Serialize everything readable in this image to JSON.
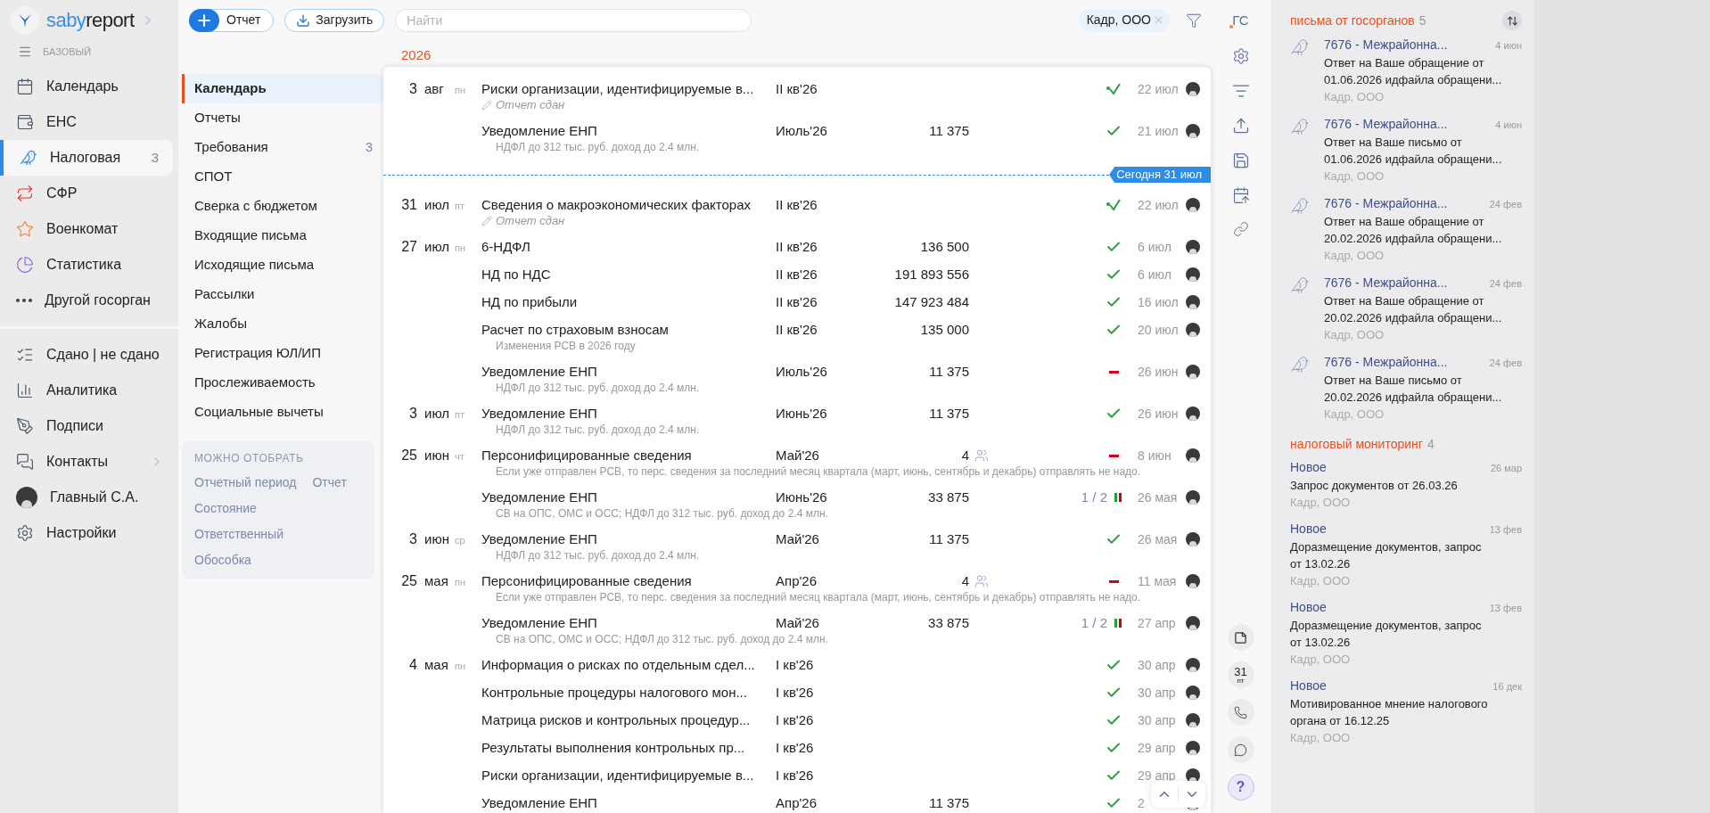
{
  "logo": {
    "brand_a": "saby",
    "brand_b": "report"
  },
  "plan": "БАЗОВЫЙ",
  "nav_items": [
    {
      "label": "Календарь",
      "selected": false
    },
    {
      "label": "ЕНС",
      "selected": false
    },
    {
      "label": "Налоговая",
      "count": "3",
      "selected": true
    },
    {
      "label": "СФР",
      "selected": false
    },
    {
      "label": "Военкомат",
      "selected": false
    },
    {
      "label": "Статистика",
      "selected": false
    },
    {
      "label": "Другой госорган",
      "selected": false
    }
  ],
  "nav_items_2": [
    {
      "label": "Сдано | не сдано",
      "kind": "link"
    },
    {
      "label": "Аналитика",
      "kind": "link"
    },
    {
      "label": "Подписи",
      "kind": "link"
    },
    {
      "label": "Контакты",
      "kind": "expandable"
    },
    {
      "label": "Главный С.А.",
      "kind": "user"
    },
    {
      "label": "Настройки",
      "kind": "link"
    }
  ],
  "toolbar": {
    "buttons": [
      "Отчет",
      "Загрузить"
    ],
    "search_placeholder": "Найти",
    "filter_chip": "Кадр, ООО"
  },
  "sections": [
    {
      "label": "Календарь",
      "selected": true
    },
    {
      "label": "Отчеты",
      "selected": false
    },
    {
      "label": "Требования",
      "count": "3",
      "selected": false
    },
    {
      "label": "СПОТ",
      "selected": false
    },
    {
      "label": "Сверка с бюджетом",
      "selected": false
    },
    {
      "label": "Входящие письма",
      "selected": false
    },
    {
      "label": "Исходящие письма",
      "selected": false
    },
    {
      "label": "Рассылки",
      "selected": false
    },
    {
      "label": "Жалобы",
      "selected": false
    },
    {
      "label": "Регистрация ЮЛ/ИП",
      "selected": false
    },
    {
      "label": "Прослеживаемость",
      "selected": false
    },
    {
      "label": "Социальные вычеты",
      "selected": false
    }
  ],
  "filter_box": {
    "title": "МОЖНО ОТОБРАТЬ",
    "links": [
      [
        "Отчетный период",
        "Отчет"
      ],
      [
        "Состояние"
      ],
      [
        "Ответственный"
      ],
      [
        "Обособка"
      ]
    ]
  },
  "year": "2026",
  "rows": [
    {
      "kind": "entry",
      "day": "3",
      "month": "авг",
      "weekday": "пн",
      "title": "Риски организации, идентифицируемые в...",
      "note": {
        "kind": "signed",
        "text": "Отчет сдан"
      },
      "period": "II кв'26",
      "status": {
        "kind": "sent"
      },
      "date": "22 июл"
    },
    {
      "kind": "entry",
      "title": "Уведомление ЕНП",
      "note": {
        "kind": "plain",
        "text": "НДФЛ до 312 тыс. руб. доход до 2.4 млн."
      },
      "period": "Июль'26",
      "amount": "11 375",
      "status": {
        "kind": "done"
      },
      "date": "21 июл"
    },
    {
      "kind": "today",
      "label": "Сегодня 31 июл"
    },
    {
      "kind": "entry",
      "day": "31",
      "month": "июл",
      "weekday": "пт",
      "title": "Сведения о макроэкономических факторах",
      "note": {
        "kind": "signed",
        "text": "Отчет сдан"
      },
      "period": "II кв'26",
      "status": {
        "kind": "sent"
      },
      "date": "22 июл"
    },
    {
      "kind": "entry",
      "day": "27",
      "month": "июл",
      "weekday": "пн",
      "title": "6-НДФЛ",
      "period": "II кв'26",
      "amount": "136 500",
      "status": {
        "kind": "done"
      },
      "date": "6 июл"
    },
    {
      "kind": "entry",
      "title": "НД по НДС",
      "period": "II кв'26",
      "amount": "191 893 556",
      "status": {
        "kind": "done"
      },
      "date": "6 июл"
    },
    {
      "kind": "entry",
      "title": "НД по прибыли",
      "period": "II кв'26",
      "amount": "147 923 484",
      "status": {
        "kind": "done"
      },
      "date": "16 июл"
    },
    {
      "kind": "entry",
      "title": "Расчет по страховым взносам",
      "note": {
        "kind": "plain",
        "text": "Изменения РСВ в 2026 году"
      },
      "period": "II кв'26",
      "amount": "135 000",
      "status": {
        "kind": "done"
      },
      "date": "20 июл"
    },
    {
      "kind": "entry",
      "title": "Уведомление ЕНП",
      "note": {
        "kind": "plain",
        "text": "НДФЛ до 312 тыс. руб. доход до 2.4 млн."
      },
      "period": "Июль'26",
      "amount": "11 375",
      "status": {
        "kind": "error"
      },
      "date": "26 июн"
    },
    {
      "kind": "entry",
      "day": "3",
      "month": "июл",
      "weekday": "пт",
      "title": "Уведомление ЕНП",
      "note": {
        "kind": "plain",
        "text": "НДФЛ до 312 тыс. руб. доход до 2.4 млн."
      },
      "period": "Июнь'26",
      "amount": "11 375",
      "status": {
        "kind": "done"
      },
      "date": "26 июн"
    },
    {
      "kind": "entry",
      "day": "25",
      "month": "июн",
      "weekday": "чт",
      "title": "Персонифицированные сведения",
      "note": {
        "kind": "plain",
        "text": "Если уже отправлен РСВ, то перс. сведения за последний месяц квартала (март, июнь, сентябрь и декабрь) отправлять не надо."
      },
      "period": "Май'26",
      "recipients": "4",
      "status": {
        "kind": "error"
      },
      "date": "8 июн"
    },
    {
      "kind": "entry",
      "title": "Уведомление ЕНП",
      "note": {
        "kind": "plain",
        "text": "СВ на ОПС, ОМС и ОСС; НДФЛ до 312 тыс. руб. доход до 2.4 млн."
      },
      "period": "Июнь'26",
      "amount": "33 875",
      "status": {
        "kind": "partial",
        "progress": "1 / 2"
      },
      "date": "26 мая"
    },
    {
      "kind": "entry",
      "day": "3",
      "month": "июн",
      "weekday": "ср",
      "title": "Уведомление ЕНП",
      "note": {
        "kind": "plain",
        "text": "НДФЛ до 312 тыс. руб. доход до 2.4 млн."
      },
      "period": "Май'26",
      "amount": "11 375",
      "status": {
        "kind": "done"
      },
      "date": "26 мая"
    },
    {
      "kind": "entry",
      "day": "25",
      "month": "мая",
      "weekday": "пн",
      "title": "Персонифицированные сведения",
      "note": {
        "kind": "plain",
        "text": "Если уже отправлен РСВ, то перс. сведения за последний месяц квартала (март, июнь, сентябрь и декабрь) отправлять не надо."
      },
      "period": "Апр'26",
      "recipients": "4",
      "status": {
        "kind": "error"
      },
      "date": "11 мая"
    },
    {
      "kind": "entry",
      "title": "Уведомление ЕНП",
      "note": {
        "kind": "plain",
        "text": "СВ на ОПС, ОМС и ОСС; НДФЛ до 312 тыс. руб. доход до 2.4 млн."
      },
      "period": "Май'26",
      "amount": "33 875",
      "status": {
        "kind": "partial",
        "progress": "1 / 2"
      },
      "date": "27 апр"
    },
    {
      "kind": "entry",
      "day": "4",
      "month": "мая",
      "weekday": "пн",
      "title": "Информация о рисках по отдельным сдел...",
      "period": "I кв'26",
      "status": {
        "kind": "done"
      },
      "date": "30 апр"
    },
    {
      "kind": "entry",
      "title": "Контрольные процедуры налогового мон...",
      "period": "I кв'26",
      "status": {
        "kind": "done"
      },
      "date": "30 апр"
    },
    {
      "kind": "entry",
      "title": "Матрица рисков и контрольных процедур...",
      "period": "I кв'26",
      "status": {
        "kind": "done"
      },
      "date": "30 апр"
    },
    {
      "kind": "entry",
      "title": "Результаты выполнения контрольных пр...",
      "period": "I кв'26",
      "status": {
        "kind": "done"
      },
      "date": "29 апр"
    },
    {
      "kind": "entry",
      "title": "Риски организации, идентифицируемые в...",
      "period": "I кв'26",
      "status": {
        "kind": "done"
      },
      "date": "29 апр"
    },
    {
      "kind": "entry",
      "title": "Уведомление ЕНП",
      "period": "Апр'26",
      "amount": "11 375",
      "status": {
        "kind": "done"
      },
      "date": "2"
    }
  ],
  "side_tools": {
    "top_label": "ГС",
    "calendar_day": "31",
    "calendar_weekday": "пт",
    "help": "?"
  },
  "letters": {
    "title": "письма от госорганов",
    "count": "5",
    "items": [
      {
        "sender": "7676 - Межрайонна...",
        "date": "4 июн",
        "text": "Ответ на Ваше обращение от 01.06.2026 идфайла обращени...",
        "org": "Кадр, ООО"
      },
      {
        "sender": "7676 - Межрайонна...",
        "date": "4 июн",
        "text": "Ответ на Ваше письмо от 01.06.2026 идфайла обращени...",
        "org": "Кадр, ООО"
      },
      {
        "sender": "7676 - Межрайонна...",
        "date": "24 фев",
        "text": "Ответ на Ваше обращение от 20.02.2026 идфайла обращени...",
        "org": "Кадр, ООО"
      },
      {
        "sender": "7676 - Межрайонна...",
        "date": "24 фев",
        "text": "Ответ на Ваше обращение от 20.02.2026 идфайла обращени...",
        "org": "Кадр, ООО"
      },
      {
        "sender": "7676 - Межрайонна...",
        "date": "24 фев",
        "text": "Ответ на Ваше письмо от 20.02.2026 идфайла обращени...",
        "org": "Кадр, ООО"
      }
    ]
  },
  "monitoring": {
    "title": "налоговый мониторинг",
    "count": "4",
    "items": [
      {
        "status": "Новое",
        "date": "26 мар",
        "text": "Запрос документов от 26.03.26",
        "org": "Кадр, ООО"
      },
      {
        "status": "Новое",
        "date": "13 фев",
        "text": "Доразмещение документов, запрос от 13.02.26",
        "org": "Кадр, ООО"
      },
      {
        "status": "Новое",
        "date": "13 фев",
        "text": "Доразмещение документов, запрос от 13.02.26",
        "org": "Кадр, ООО"
      },
      {
        "status": "Новое",
        "date": "16 дек",
        "text": "Мотивированное мнение налогового органа от 16.12.25",
        "org": "Кадр, ООО"
      }
    ]
  }
}
